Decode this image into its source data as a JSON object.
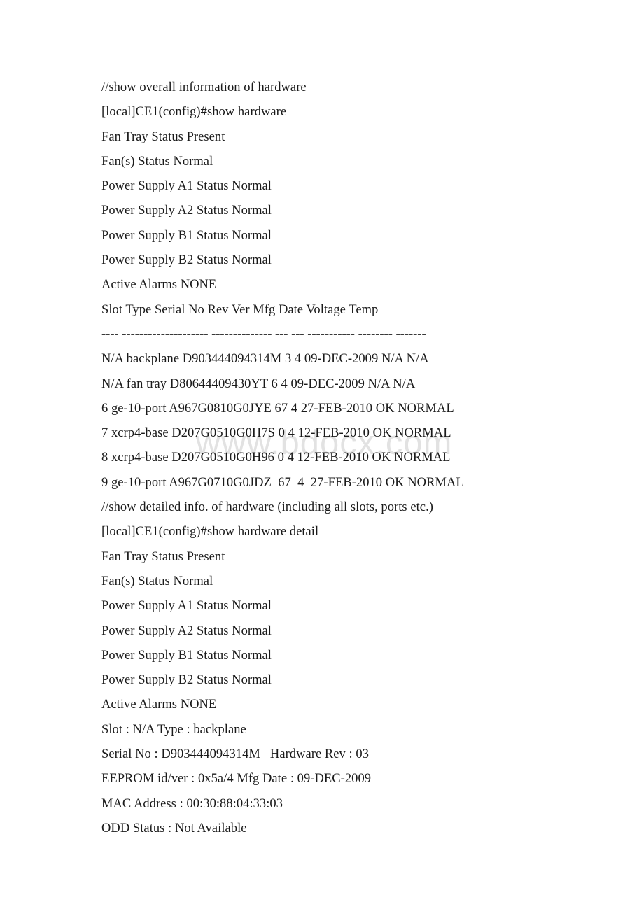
{
  "document": {
    "watermark": "www.bdocx.com",
    "watermark_color": "#e2e2e2",
    "text_color": "#1a1a1a",
    "background_color": "#ffffff",
    "lines": [
      {
        "id": "comment-overall",
        "text": "//show overall information of hardware"
      },
      {
        "id": "prompt-show-hardware",
        "text": "[local]CE1(config)#show hardware"
      },
      {
        "id": "fan-tray-status-1",
        "text": "Fan Tray Status Present"
      },
      {
        "id": "fans-status-1",
        "text": "Fan(s) Status Normal"
      },
      {
        "id": "power-supply-a1-1",
        "text": "Power Supply A1 Status Normal"
      },
      {
        "id": "power-supply-a2-1",
        "text": "Power Supply A2 Status Normal"
      },
      {
        "id": "power-supply-b1-1",
        "text": "Power Supply B1 Status Normal"
      },
      {
        "id": "power-supply-b2-1",
        "text": "Power Supply B2 Status Normal"
      },
      {
        "id": "active-alarms-1",
        "text": "Active Alarms NONE"
      },
      {
        "id": "table-header",
        "text": "Slot Type Serial No Rev Ver Mfg Date Voltage Temp"
      },
      {
        "id": "table-rule",
        "text": "---- -------------------- -------------- --- --- ----------- -------- -------",
        "rule": true
      },
      {
        "id": "row-backplane",
        "text": "N/A backplane D903444094314M 3 4 09-DEC-2009 N/A N/A"
      },
      {
        "id": "row-fan-tray",
        "text": "N/A fan tray D80644409430YT 6 4 09-DEC-2009 N/A N/A"
      },
      {
        "id": "row-slot-6",
        "text": "6 ge-10-port A967G0810G0JYE 67 4 27-FEB-2010 OK NORMAL"
      },
      {
        "id": "row-slot-7",
        "text": "7 xcrp4-base D207G0510G0H7S 0 4 12-FEB-2010 OK NORMAL"
      },
      {
        "id": "row-slot-8",
        "text": "8 xcrp4-base D207G0510G0H96 0 4 12-FEB-2010 OK NORMAL"
      },
      {
        "id": "row-slot-9",
        "text": "9 ge-10-port A967G0710G0JDZ  67  4  27-FEB-2010 OK NORMAL"
      },
      {
        "id": "comment-detail",
        "text": "//show detailed info. of hardware (including all slots, ports etc.)"
      },
      {
        "id": "prompt-show-hardware-detail",
        "text": "[local]CE1(config)#show hardware detail"
      },
      {
        "id": "fan-tray-status-2",
        "text": "Fan Tray Status Present"
      },
      {
        "id": "fans-status-2",
        "text": "Fan(s) Status Normal"
      },
      {
        "id": "power-supply-a1-2",
        "text": "Power Supply A1 Status Normal"
      },
      {
        "id": "power-supply-a2-2",
        "text": "Power Supply A2 Status Normal"
      },
      {
        "id": "power-supply-b1-2",
        "text": "Power Supply B1 Status Normal"
      },
      {
        "id": "power-supply-b2-2",
        "text": "Power Supply B2 Status Normal"
      },
      {
        "id": "active-alarms-2",
        "text": "Active Alarms NONE"
      },
      {
        "id": "detail-slot-type",
        "text": "Slot : N/A Type : backplane"
      },
      {
        "id": "detail-serial-rev",
        "text": "Serial No : D903444094314M   Hardware Rev : 03"
      },
      {
        "id": "detail-eeprom-mfg",
        "text": "EEPROM id/ver : 0x5a/4 Mfg Date : 09-DEC-2009"
      },
      {
        "id": "detail-mac-address",
        "text": "MAC Address : 00:30:88:04:33:03"
      },
      {
        "id": "detail-odd-status",
        "text": "ODD Status : Not Available"
      }
    ]
  }
}
